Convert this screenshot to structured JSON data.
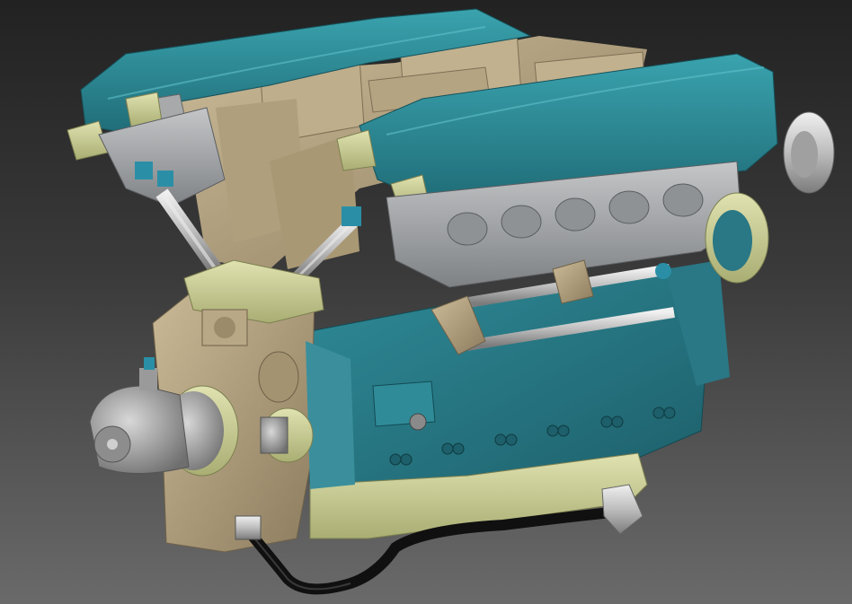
{
  "scene": {
    "subject": "engine-cad-model",
    "colors": {
      "valve_cover": "#2e8f9b",
      "valve_cover_dark": "#1f6c77",
      "block_blue": "#2b7f8c",
      "block_blue_dark": "#1d5f6a",
      "casting_tan": "#b9a886",
      "casting_tan_dark": "#8d7d5f",
      "bracket_yellow": "#d6d9a2",
      "bracket_yellow_dark": "#a9ae73",
      "steel_gray": "#c9c9c9",
      "steel_gray_dark": "#8b8b8b",
      "head_gray": "#a7a9ab",
      "hose_black": "#101010",
      "connector_cyan": "#2a8fa6"
    }
  }
}
